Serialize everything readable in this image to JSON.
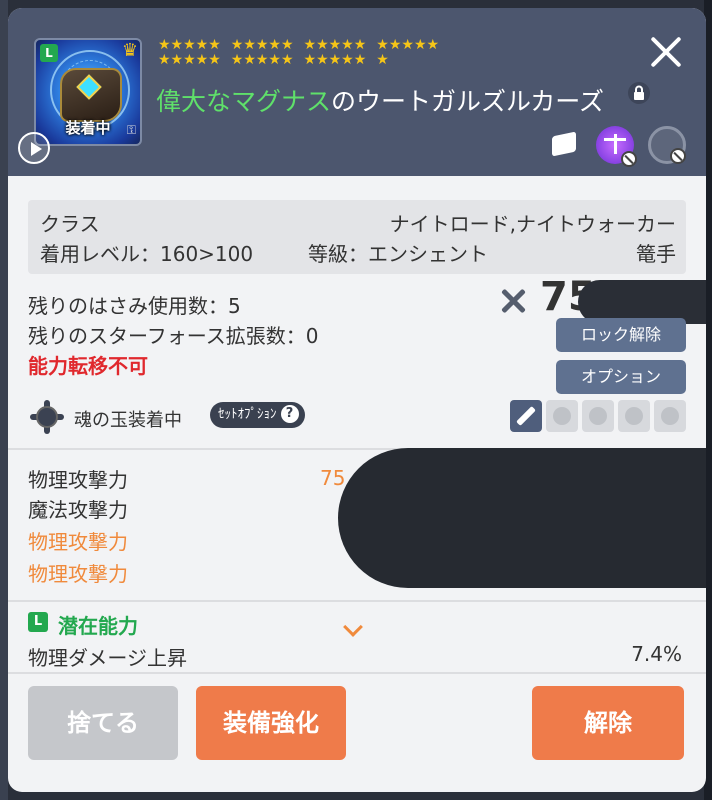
{
  "item": {
    "badge": "L",
    "equipped_label": "装着中",
    "name_highlight": "偉大なマグナス",
    "name_rest": "のウートガルズルカーズ",
    "stars_row1": [
      "★★★★★",
      "★★★★★",
      "★★★★★",
      "★★★★★"
    ],
    "stars_row2": [
      "★★★★★",
      "★★★★★",
      "★★★★★",
      "★"
    ]
  },
  "info": {
    "class_label": "クラス",
    "class_value": "ナイトロード,ナイトウォーカー",
    "level_text": "着用レベル：160>100",
    "grade_text": "等級：エンシェント",
    "type": "篭手"
  },
  "details": {
    "scissors_text": "残りのはさみ使用数：5",
    "starforce_text": "残りのスターフォース拡張数：0",
    "transfer_text": "能力転移不可",
    "power_value": "75",
    "unlock_button": "ロック解除",
    "option_button": "オプション",
    "soul_text": "魂の玉装着中",
    "set_option_label": "ｾｯﾄｵﾌﾟｼｮﾝ",
    "help_mark": "?"
  },
  "stats": {
    "labels": [
      "物理攻撃力",
      "魔法攻撃力",
      "物理攻撃力",
      "物理攻撃力"
    ],
    "first_value": "75"
  },
  "potential": {
    "badge": "L",
    "title": "潜在能力",
    "stat_label": "物理ダメージ上昇",
    "stat_value": "7.4%"
  },
  "buttons": {
    "discard": "捨てる",
    "enhance": "装備強化",
    "release": "解除"
  },
  "colors": {
    "header_bg": "#4c566e",
    "accent_orange": "#ef7b4a",
    "legendary_green": "#23a84f",
    "warning_red": "#e0282d"
  },
  "icons": [
    "play-icon",
    "close-icon",
    "lock-icon",
    "inventory-box-icon",
    "balance-scale-icon",
    "cycle-icon",
    "crossed-swords-icon",
    "soul-orb-icon",
    "help-icon",
    "chevron-down-icon"
  ]
}
